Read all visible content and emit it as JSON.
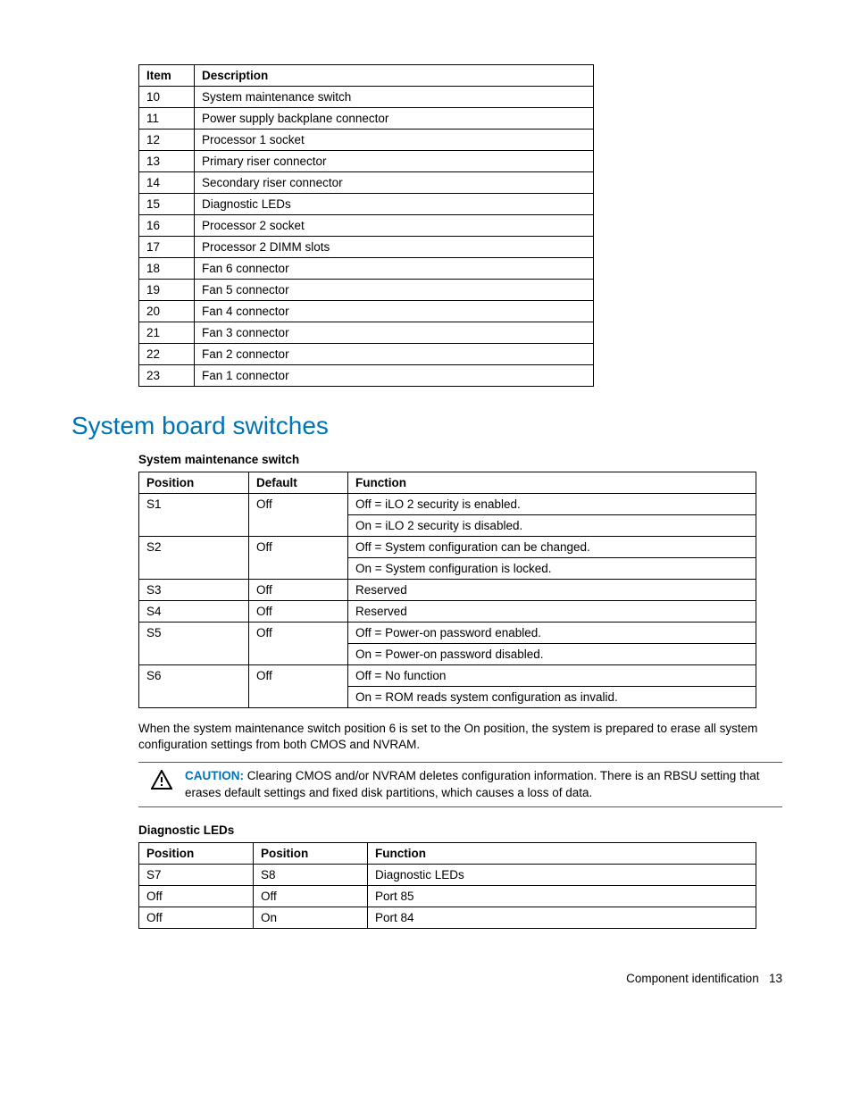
{
  "table1": {
    "head": [
      "Item",
      "Description"
    ],
    "rows": [
      [
        "10",
        "System maintenance switch"
      ],
      [
        "11",
        "Power supply backplane connector"
      ],
      [
        "12",
        "Processor 1 socket"
      ],
      [
        "13",
        "Primary riser connector"
      ],
      [
        "14",
        "Secondary riser connector"
      ],
      [
        "15",
        "Diagnostic LEDs"
      ],
      [
        "16",
        "Processor 2 socket"
      ],
      [
        "17",
        "Processor 2 DIMM slots"
      ],
      [
        "18",
        "Fan 6 connector"
      ],
      [
        "19",
        "Fan 5 connector"
      ],
      [
        "20",
        "Fan 4 connector"
      ],
      [
        "21",
        "Fan 3 connector"
      ],
      [
        "22",
        "Fan 2 connector"
      ],
      [
        "23",
        "Fan 1 connector"
      ]
    ]
  },
  "heading": "System board switches",
  "sub1": "System maintenance switch",
  "table2": {
    "head": [
      "Position",
      "Default",
      "Function"
    ],
    "rows": [
      [
        "S1",
        "Off",
        "Off = iLO 2 security is enabled."
      ],
      [
        "",
        "",
        "On = iLO 2 security is disabled."
      ],
      [
        "S2",
        "Off",
        "Off = System configuration can be changed."
      ],
      [
        "",
        "",
        "On = System configuration is locked."
      ],
      [
        "S3",
        "Off",
        "Reserved"
      ],
      [
        "S4",
        "Off",
        "Reserved"
      ],
      [
        "S5",
        "Off",
        "Off = Power-on password enabled."
      ],
      [
        "",
        "",
        "On = Power-on password disabled."
      ],
      [
        "S6",
        "Off",
        "Off = No function"
      ],
      [
        "",
        "",
        "On = ROM reads system configuration as invalid."
      ]
    ],
    "merges": [
      {
        "start": 0,
        "span": 2,
        "cols": [
          0,
          1
        ]
      },
      {
        "start": 2,
        "span": 2,
        "cols": [
          0,
          1
        ]
      },
      {
        "start": 6,
        "span": 2,
        "cols": [
          0,
          1
        ]
      },
      {
        "start": 8,
        "span": 2,
        "cols": [
          0,
          1
        ]
      }
    ]
  },
  "para": "When the system maintenance switch position 6 is set to the On position, the system is prepared to erase all system configuration settings from both CMOS and NVRAM.",
  "caution": {
    "label": "CAUTION:",
    "text": "  Clearing CMOS and/or NVRAM deletes configuration information. There is an RBSU setting that erases default settings and fixed disk partitions, which causes a loss of data."
  },
  "sub2": "Diagnostic LEDs",
  "table3": {
    "head": [
      "Position",
      "Position",
      "Function"
    ],
    "rows": [
      [
        "S7",
        "S8",
        "Diagnostic LEDs"
      ],
      [
        "Off",
        "Off",
        "Port 85"
      ],
      [
        "Off",
        "On",
        "Port 84"
      ]
    ]
  },
  "footer": {
    "section": "Component identification",
    "page": "13"
  }
}
